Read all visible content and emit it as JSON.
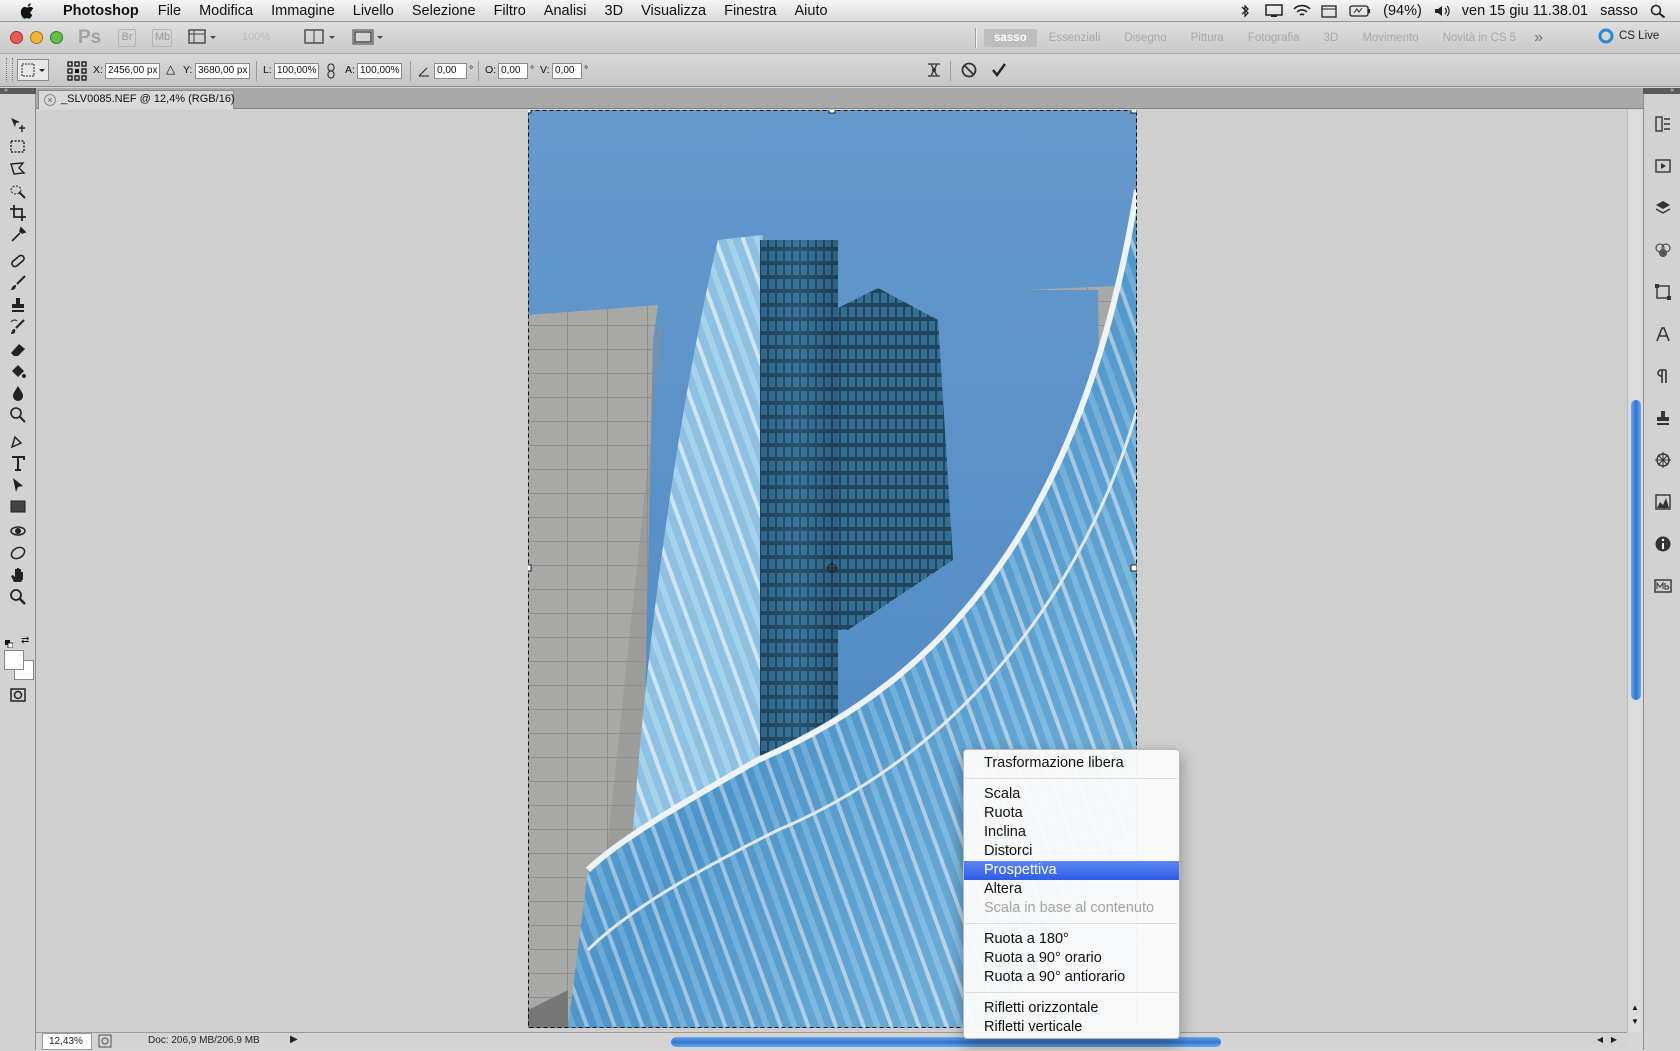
{
  "menubar": {
    "app": "Photoshop",
    "items": [
      "File",
      "Modifica",
      "Immagine",
      "Livello",
      "Selezione",
      "Filtro",
      "Analisi",
      "3D",
      "Visualizza",
      "Finestra",
      "Aiuto"
    ],
    "battery": "(94%)",
    "datetime": "ven 15 giu  11.38.01",
    "user": "sasso"
  },
  "appbar": {
    "ps": "Ps",
    "br": "Br",
    "mb": "Mb",
    "zoom": "100%",
    "workspaces": [
      "sasso",
      "Essenziali",
      "Disegno",
      "Pittura",
      "Fotografia",
      "3D",
      "Movimento",
      "Novità in CS 5"
    ],
    "more": "»",
    "cslive": "CS Live"
  },
  "options": {
    "x_label": "X:",
    "x_value": "2456,00 px",
    "y_label": "Y:",
    "y_value": "3680,00 px",
    "w_label": "L:",
    "w_value": "100,00%",
    "h_label": "A:",
    "h_value": "100,00%",
    "angle_value": "0,00",
    "o_label": "O:",
    "o_value": "0,00",
    "v_label": "V:",
    "v_value": "0,00",
    "deg": "°"
  },
  "document": {
    "tab_title": "_SLV0085.NEF @ 12,4% (RGB/16)",
    "zoom": "12,43%",
    "doc_info": "Doc: 206,9 MB/206,9 MB"
  },
  "context_menu": {
    "items": [
      {
        "label": "Trasformazione libera"
      },
      {
        "sep": true
      },
      {
        "label": "Scala"
      },
      {
        "label": "Ruota"
      },
      {
        "label": "Inclina"
      },
      {
        "label": "Distorci"
      },
      {
        "label": "Prospettiva",
        "active": true
      },
      {
        "label": "Altera"
      },
      {
        "label": "Scala in base al contenuto",
        "disabled": true
      },
      {
        "sep": true
      },
      {
        "label": "Ruota a 180°"
      },
      {
        "label": "Ruota a 90° orario"
      },
      {
        "label": "Ruota a 90° antiorario"
      },
      {
        "sep": true
      },
      {
        "label": "Rifletti orizzontale"
      },
      {
        "label": "Rifletti verticale"
      }
    ]
  },
  "colors": {
    "menu_highlight": "#2c5de5",
    "scroll_thumb": "#2f75d5",
    "sky": "#5f95c8"
  }
}
